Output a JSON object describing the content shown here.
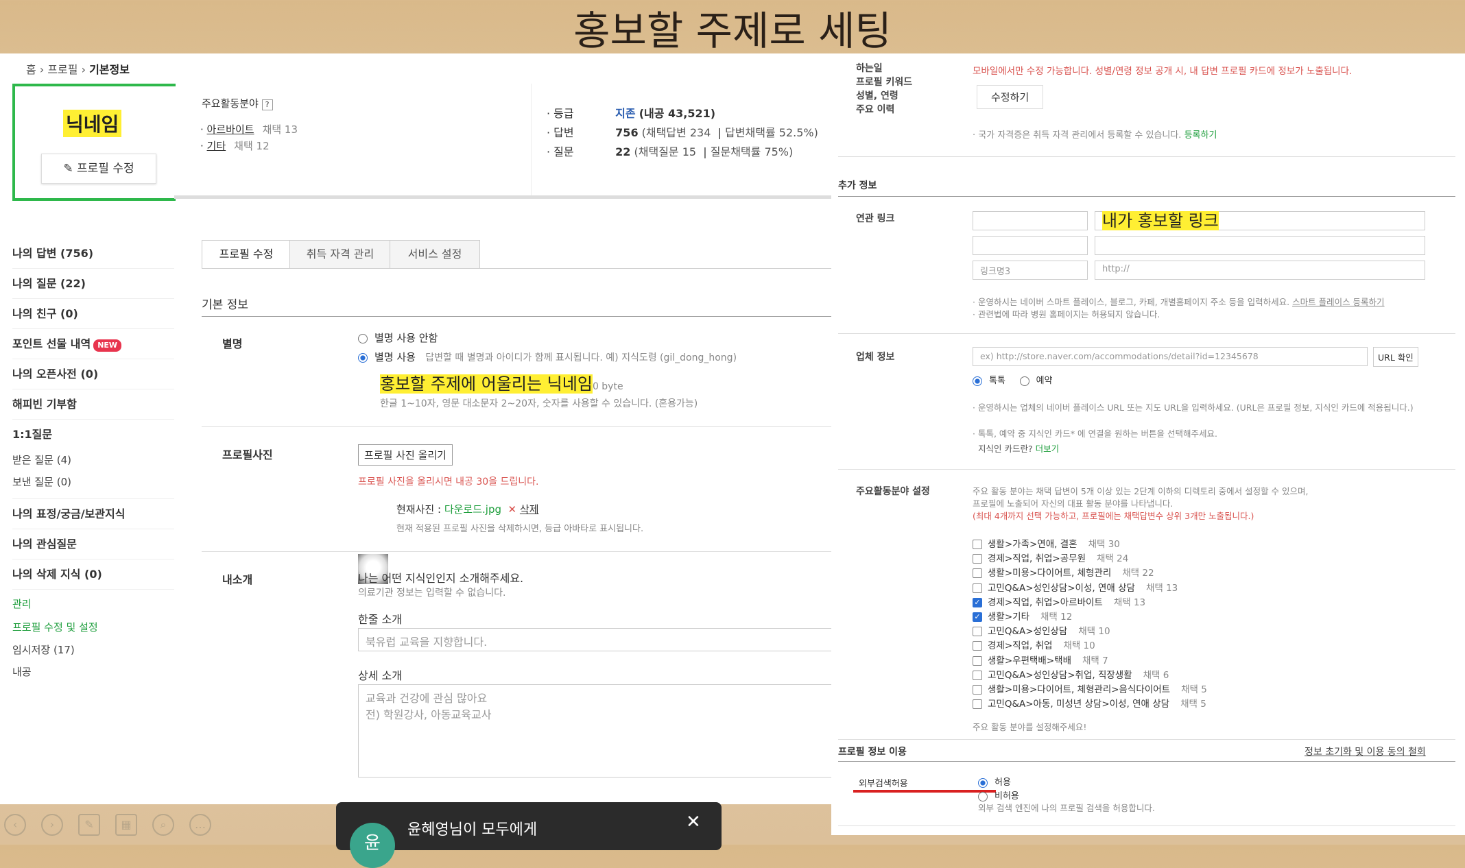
{
  "slide_title": "홍보할 주제로 세팅",
  "breadcrumb": [
    "홈",
    "프로필",
    "기본정보"
  ],
  "profile": {
    "nickname": "닉네임",
    "edit_button": "프로필 수정"
  },
  "main_area": {
    "label": "주요활동분야",
    "help": "?",
    "items": [
      {
        "name": "아르바이트",
        "count": "채택 13"
      },
      {
        "name": "기타",
        "count": "채택 12"
      }
    ]
  },
  "stats": [
    {
      "key": "등급",
      "value": "지존",
      "detail": "(내공 43,521)"
    },
    {
      "key": "답변",
      "value": "756",
      "detail": "(채택답변 234",
      "extra": "답변채택률 52.5%)"
    },
    {
      "key": "질문",
      "value": "22",
      "detail": "(채택질문 15",
      "extra": "질문채택률 75%)"
    }
  ],
  "sidebar": {
    "items": [
      "나의 답변 (756)",
      "나의 질문 (22)",
      "나의 친구 (0)",
      "포인트 선물 내역",
      "나의 오픈사전 (0)",
      "해피빈 기부함",
      "1:1질문"
    ],
    "new_badge": "NEW",
    "one_to_one": [
      "받은 질문 (4)",
      "보낸 질문 (0)"
    ],
    "items2": [
      "나의 표정/궁금/보관지식",
      "나의 관심질문",
      "나의 삭제 지식 (0)"
    ],
    "manage": "관리",
    "manage_items": [
      "프로필 수정 및 설정"
    ],
    "bottom_items": [
      "임시저장 (17)",
      "내공"
    ]
  },
  "tabs": [
    "프로필 수정",
    "취득 자격 관리",
    "서비스 설정"
  ],
  "basic_info": {
    "section": "기본 정보",
    "alias_label": "별명",
    "alias_off": "별명 사용 안함",
    "alias_on": "별명 사용",
    "alias_desc": "답변할 때 별명과 아이디가 함께 표시됩니다. 예) 지식도령 (gil_dong_hong)",
    "alias_value": "홍보할 주제에 어울리는 닉네임",
    "byte": "0 byte",
    "alias_rule": "한글 1~10자, 영문 대소문자 2~20자, 숫자를 사용할 수 있습니다. (혼용가능)",
    "photo_label": "프로필사진",
    "photo_button": "프로필 사진 올리기",
    "photo_reward": "프로필 사진을 올리시면 내공 30을 드립니다.",
    "current_photo": "현재사진 :",
    "photo_file": "다운로드.jpg",
    "delete": "삭제",
    "photo_note": "현재 적용된 프로필 사진을 삭제하시면, 등급 아바타로 표시됩니다.",
    "intro_label": "내소개",
    "intro_q": "나는 어떤 지식인인지 소개해주세요.",
    "intro_note": "의료기관 정보는 입력할 수 없습니다.",
    "oneline_label": "한줄 소개",
    "oneline_value": "북유럽 교육을 지향합니다.",
    "detail_label": "상세 소개",
    "detail_line1": "교육과 건강에 관심 많아요",
    "detail_line2": "전) 학원강사, 아동교육교사"
  },
  "right": {
    "top_labels": [
      "하는일",
      "프로필 키워드",
      "성별, 연령",
      "주요 이력"
    ],
    "mobile_note": "모바일에서만 수정 가능합니다. 성별/연령 정보 공개 시, 내 답변 프로필 카드에 정보가 노출됩니다.",
    "edit_button": "수정하기",
    "cert_note": "국가 자격증은 취득 자격 관리에서 등록할 수 있습니다.",
    "cert_link": "등록하기",
    "extra_title": "추가 정보",
    "link_label": "연관 링크",
    "link1_value": "내가 홍보할 링크",
    "link3_name": "링크명3",
    "link3_url": "http://",
    "link_note1": "운영하시는 네이버 스마트 플레이스, 블로그, 카페, 개별홈페이지 주소 등을 입력하세요.",
    "link_note1_link": "스마트 플레이스 등록하기",
    "link_note2": "관련법에 따라 병원 홈페이지는 허용되지 않습니다.",
    "biz_label": "업체 정보",
    "biz_placeholder": "ex) http://store.naver.com/accommodations/detail?id=12345678",
    "url_check": "URL 확인",
    "biz_opt1": "톡톡",
    "biz_opt2": "예약",
    "biz_note1": "운영하시는 업체의 네이버 플레이스 URL 또는 지도 URL을 입력하세요. (URL은 프로필 정보, 지식인 카드에 적용됩니다.)",
    "biz_note2": "톡톡, 예약 중 지식인 카드* 에 연결을 원하는 버튼을 선택해주세요.",
    "card_q": "지식인 카드란?",
    "card_more": "더보기",
    "area_label": "주요활동분야 설정",
    "area_note1": "주요 활동 분야는 채택 답변이 5개 이상 있는 2단계 이하의 디렉토리 중에서 설정할 수 있으며,",
    "area_note2": "프로필에 노출되어 자신의 대표 활동 분야를 나타냅니다.",
    "area_note3": "(최대 4개까지 선택 가능하고, 프로필에는 채택답변수 상위 3개만 노출됩니다.)",
    "areas": [
      {
        "name": "생활>가족>연애, 결혼",
        "count": "채택 30",
        "checked": false
      },
      {
        "name": "경제>직업, 취업>공무원",
        "count": "채택 24",
        "checked": false
      },
      {
        "name": "생활>미용>다이어트, 체형관리",
        "count": "채택 22",
        "checked": false
      },
      {
        "name": "고민Q&A>성인상담>이성, 연애 상담",
        "count": "채택 13",
        "checked": false
      },
      {
        "name": "경제>직업, 취업>아르바이트",
        "count": "채택 13",
        "checked": true
      },
      {
        "name": "생활>기타",
        "count": "채택 12",
        "checked": true
      },
      {
        "name": "고민Q&A>성인상담",
        "count": "채택 10",
        "checked": false
      },
      {
        "name": "경제>직업, 취업",
        "count": "채택 10",
        "checked": false
      },
      {
        "name": "생활>우편택배>택배",
        "count": "채택 7",
        "checked": false
      },
      {
        "name": "고민Q&A>성인상담>취업, 직장생활",
        "count": "채택 6",
        "checked": false
      },
      {
        "name": "생활>미용>다이어트, 체형관리>음식다이어트",
        "count": "채택 5",
        "checked": false
      },
      {
        "name": "고민Q&A>아동, 미성년 상담>이성, 연애 상담",
        "count": "채택 5",
        "checked": false
      }
    ],
    "area_footer": "주요 활동 분야를 설정해주세요!",
    "profile_use": "프로필 정보 이용",
    "reset_link": "정보 초기화 및 이용 동의 철회",
    "ext_search": "외부검색허용",
    "allow": "허용",
    "deny": "비허용",
    "ext_note": "외부 검색 엔진에 나의 프로필 검색을 허용합니다."
  },
  "toast": {
    "avatar": "윤",
    "message": "윤혜영님이 모두에게",
    "close": "✕"
  },
  "colors": {
    "accent_green": "#2eb84b",
    "highlight": "#ffef33",
    "link_blue": "#2a5db0",
    "red_underline": "#d92020"
  }
}
